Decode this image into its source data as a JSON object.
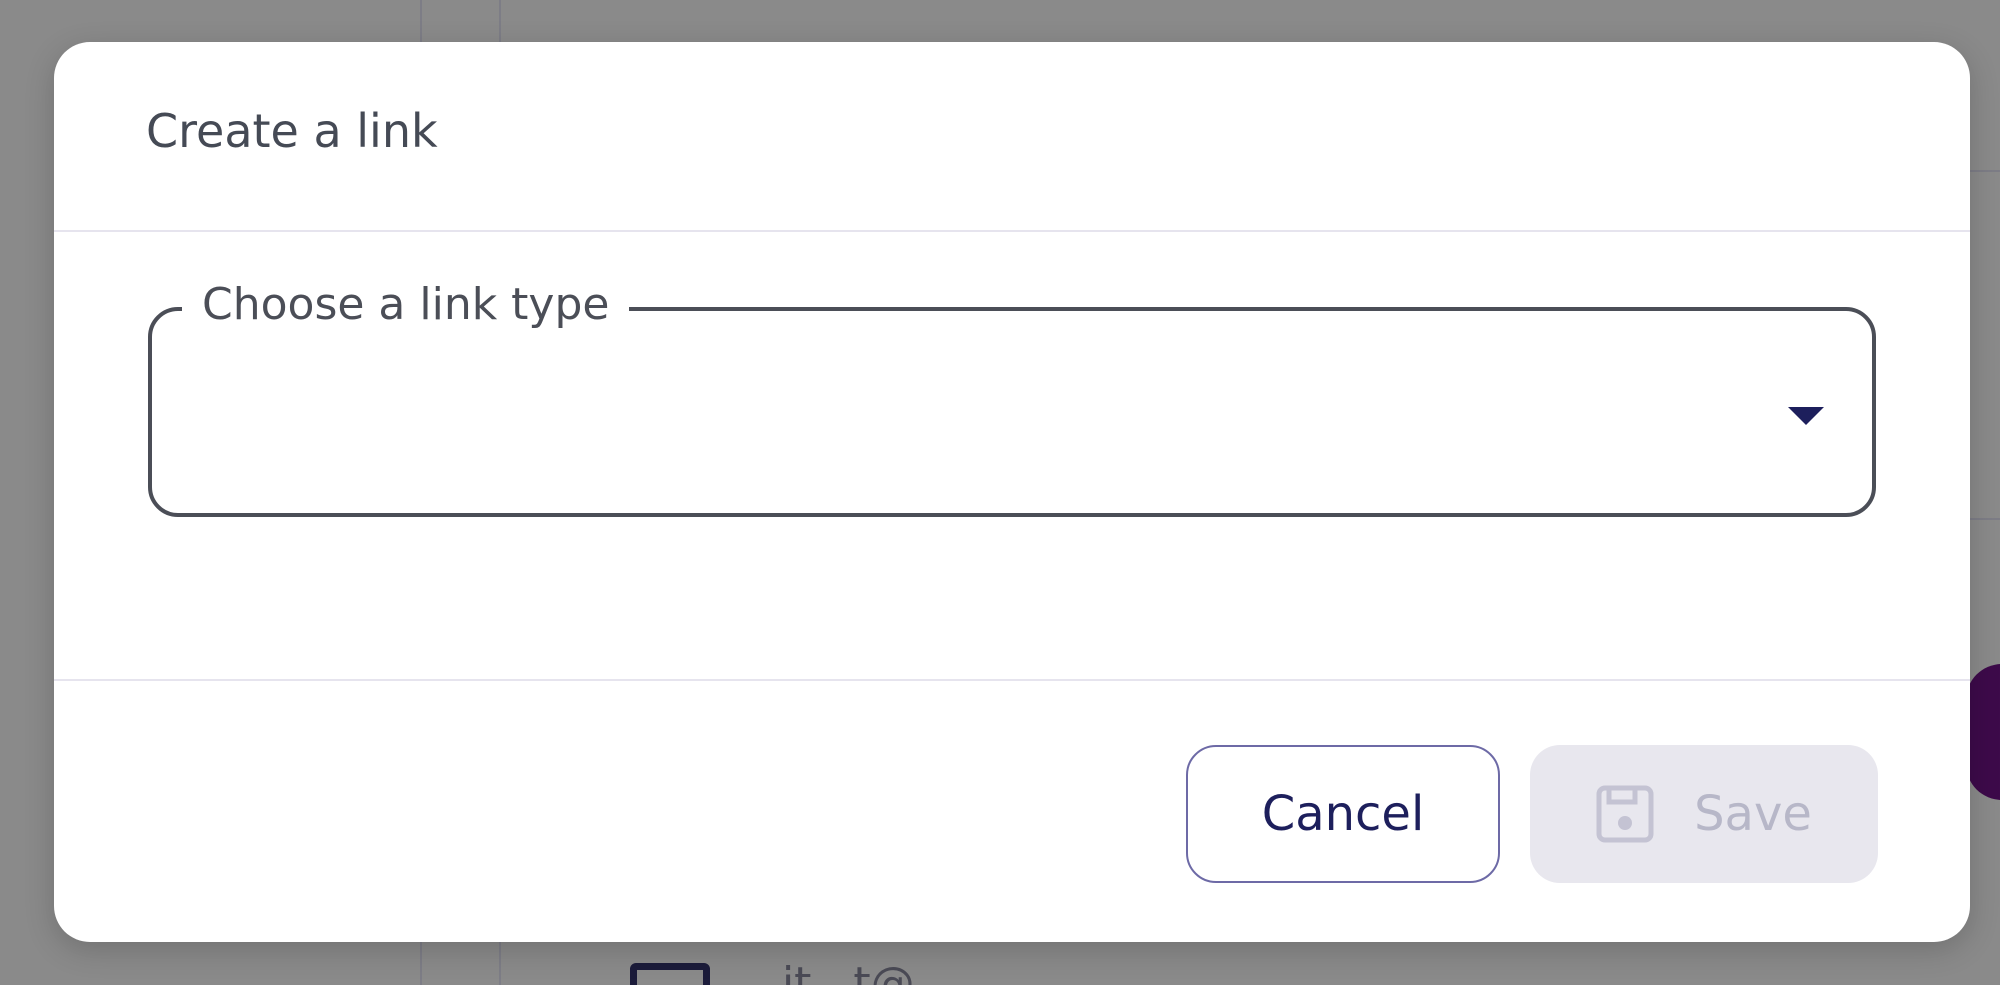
{
  "background": {
    "partial_text": "...it...t@..."
  },
  "dialog": {
    "title": "Create a link",
    "select": {
      "label": "Choose a link type",
      "value": ""
    },
    "buttons": {
      "cancel_label": "Cancel",
      "save_label": "Save"
    }
  },
  "colors": {
    "overlay": "#8a8a8a",
    "primary_text": "#1d1f5c",
    "disabled_bg": "#e8e7ee",
    "disabled_text": "#b7b7c8",
    "accent_purple": "#3d0a4a"
  },
  "icons": {
    "select_caret": "caret-down-icon",
    "save": "floppy-disk-icon",
    "background_mail": "mail-icon"
  }
}
